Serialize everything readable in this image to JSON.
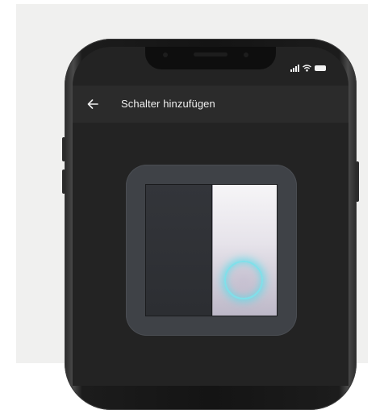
{
  "header": {
    "title": "Schalter hinzufügen",
    "back_icon": "arrow-left-icon"
  },
  "status_bar": {
    "icons": [
      "signal-icon",
      "wifi-icon",
      "battery-icon"
    ]
  },
  "illustration": {
    "description_icon": "light-switch-icon",
    "highlight_icon": "touch-ring-icon",
    "colors": {
      "highlight": "#7fe0ea",
      "screen": "#232323",
      "header": "#2b2b2b",
      "frame": "#3f4247"
    }
  }
}
